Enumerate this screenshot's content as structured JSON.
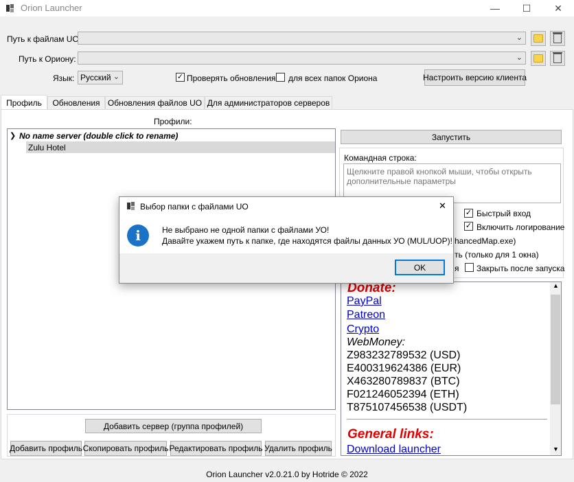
{
  "window": {
    "title": "Orion Launcher",
    "minimize_glyph": "—",
    "maximize_glyph": "☐",
    "close_glyph": "✕"
  },
  "paths": {
    "uo_label": "Путь к файлам UO:",
    "uo_value": "",
    "orion_label": "Путь к Ориону:",
    "orion_value": "",
    "language_label": "Язык:",
    "language_value": "Русский",
    "check_updates_label": "Проверять обновления",
    "check_updates_checked": true,
    "all_orion_folders_label": "для всех папок Ориона",
    "all_orion_folders_checked": false,
    "configure_client_button": "Настроить версию клиента"
  },
  "tabs": [
    {
      "label": "Профиль",
      "active": true
    },
    {
      "label": "Обновления",
      "active": false
    },
    {
      "label": "Обновления файлов UO",
      "active": false
    },
    {
      "label": "Для администраторов серверов",
      "active": false
    }
  ],
  "profile": {
    "profiles_label": "Профили:",
    "tree": {
      "server_name": "No name server (double click to rename)",
      "profiles": [
        "Zulu Hotel"
      ]
    },
    "add_server_button": "Добавить сервер (группа профилей)",
    "add_profile_button": "Добавить профиль",
    "copy_profile_button": "Скопировать профиль",
    "edit_profile_button": "Редактировать профиль",
    "delete_profile_button": "Удалить профиль"
  },
  "right_panel": {
    "launch_button": "Запустить",
    "command_line_label": "Командная строка:",
    "command_line_placeholder": "Щелкните правой кнопкой мыши, чтобы открыть дополнительные параметры",
    "fast_login_label": "Быстрый вход",
    "fast_login_checked": true,
    "logging_label": "Включить логирование",
    "logging_checked": true,
    "enhanced_map_partial": "hancedMap.exe)",
    "one_window_partial": "ть (только для 1 окна)",
    "partial_ya": "я",
    "close_after_launch_label": "Закрыть после запуска",
    "close_after_launch_checked": false
  },
  "donate": {
    "title": "Donate:",
    "links": [
      "PayPal",
      "Patreon",
      "Crypto"
    ],
    "webmoney_label": "WebMoney:",
    "wallets": [
      "Z983232789532 (USD)",
      "E400319624386 (EUR)",
      "X463280789837 (BTC)",
      "F021246052394 (ETH)",
      "T875107456538 (USDT)"
    ],
    "general_title": "General links:",
    "download_link": "Download launcher"
  },
  "footer": {
    "text": "Orion Launcher v2.0.21.0 by Hotride © 2022"
  },
  "dialog": {
    "title": "Выбор папки с файлами UO",
    "line1": "Не выбрано не одной папки с файлами УО!",
    "line2": "Давайте укажем путь к папке, где находятся файлы данных УО (MUL/UOP)!",
    "ok_button": "OK",
    "close_glyph": "✕",
    "icon_glyph": "i"
  },
  "colors": {
    "accent": "#0078d7",
    "donate_red": "#e00000",
    "link_blue": "#0000cc",
    "info_blue": "#1a73c7"
  }
}
